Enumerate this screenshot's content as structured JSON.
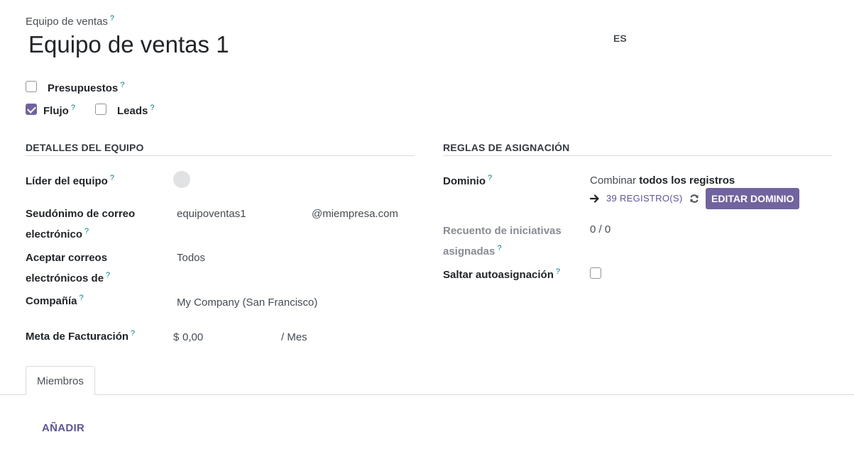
{
  "header": {
    "field_label": "Equipo de ventas",
    "name_value": "Equipo de ventas 1",
    "lang_badge": "ES"
  },
  "options": {
    "quotations_label": "Presupuestos",
    "quotations_checked": false,
    "pipeline_label": "Flujo",
    "pipeline_checked": true,
    "leads_label": "Leads",
    "leads_checked": false
  },
  "team_details": {
    "title": "DETALLES DEL EQUIPO",
    "leader_label": "Líder del equipo",
    "alias_label_line1": "Seudónimo de correo",
    "alias_label_line2": "electrónico",
    "alias_value": "equipoventas1",
    "alias_domain": "@miempresa.com",
    "accept_label_line1": "Aceptar correos",
    "accept_label_line2": "electrónicos de",
    "accept_value": "Todos",
    "company_label": "Compañía",
    "company_value": "My Company (San Francisco)",
    "target_label": "Meta de Facturación",
    "target_currency": "$",
    "target_value": "0,00",
    "target_period": "/ Mes"
  },
  "assignment": {
    "title": "REGLAS DE ASIGNACIÓN",
    "domain_label": "Dominio",
    "domain_prefix": "Combinar",
    "domain_bold": "todos los registros",
    "records_link": "39 REGISTRO(S)",
    "edit_domain_button": "EDITAR DOMINIO",
    "count_label_line1": "Recuento de iniciativas",
    "count_label_line2": "asignadas",
    "count_value": "0 / 0",
    "skip_label": "Saltar autoasignación",
    "skip_checked": false
  },
  "tabs": [
    {
      "label": "Miembros",
      "active": true
    }
  ],
  "members": {
    "add_label": "AÑADIR"
  },
  "help_mark": "?"
}
